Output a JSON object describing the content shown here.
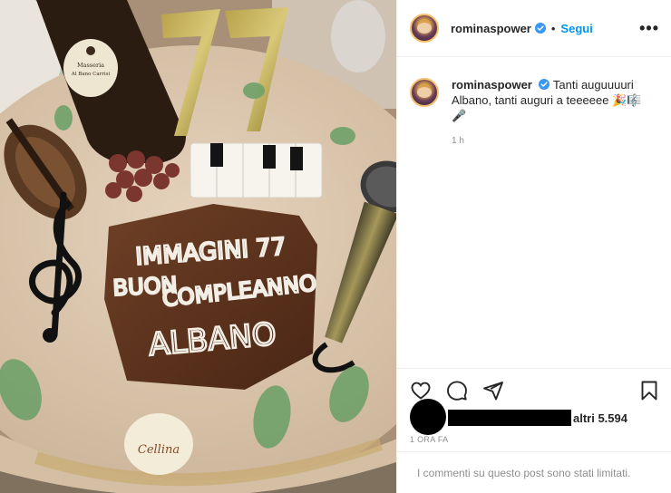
{
  "post": {
    "author": {
      "username": "rominaspower",
      "verified": true,
      "follow_label": "Segui",
      "more_icon": "more-horizontal-icon"
    },
    "caption": {
      "username": "rominaspower",
      "text": "Tanti auguuuuri Albano, tanti auguri a teeeeee 🎉🎼🎤",
      "time": "1 h"
    },
    "actions": {
      "like_icon": "heart-icon",
      "comment_icon": "comment-icon",
      "share_icon": "paper-plane-icon",
      "save_icon": "bookmark-icon"
    },
    "likes": {
      "text": "altri 5.594"
    },
    "timestamp": "1 ORA FA",
    "comments_notice": "I commenti su questo post sono stati limitati."
  },
  "photo": {
    "cake_lines": [
      "IMMAGINI 77",
      "BUON",
      "COMPLEANNO",
      "ALBANO"
    ],
    "candle_number": "77",
    "label_top": [
      "Masseria",
      "Al Bano Carrisi"
    ],
    "label_bottom": "Cellina",
    "colors": {
      "verified_blue": "#3897f0",
      "follow_blue": "#0095f6",
      "border": "#efefef"
    }
  }
}
